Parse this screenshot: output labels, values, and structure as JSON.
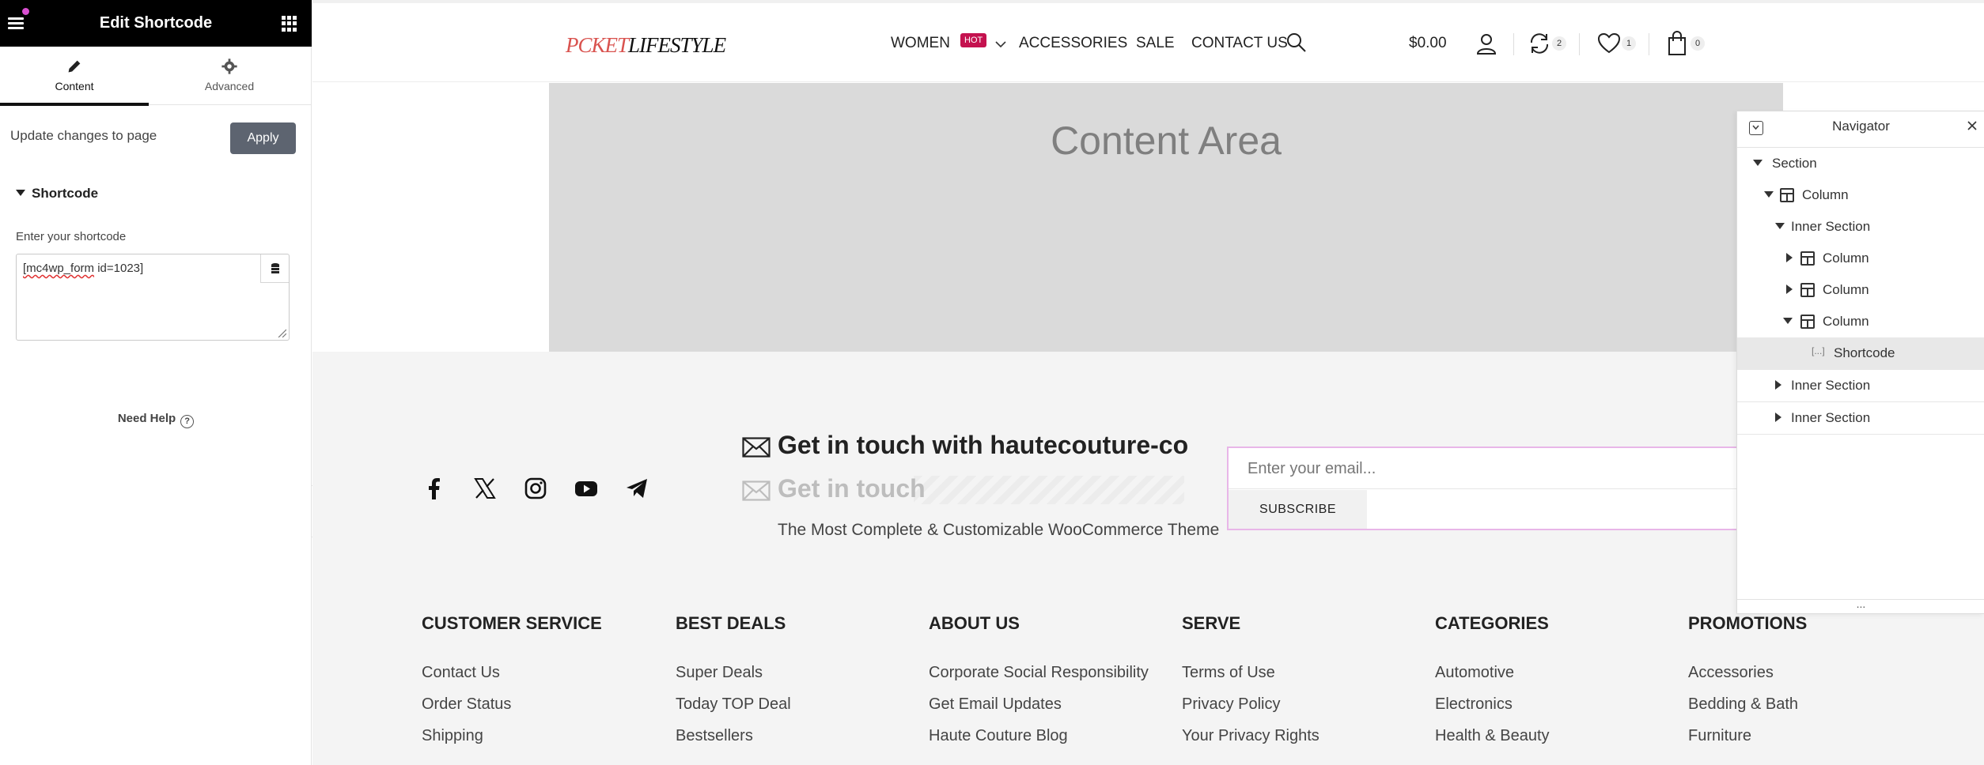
{
  "editor": {
    "title": "Edit Shortcode",
    "tabs": [
      {
        "label": "Content",
        "icon": "pencil-icon",
        "active": true
      },
      {
        "label": "Advanced",
        "icon": "gear-icon",
        "active": false
      }
    ],
    "update_text": "Update changes to page",
    "apply_label": "Apply",
    "section_title": "Shortcode",
    "field_label": "Enter your shortcode",
    "shortcode_value_a": "[mc4wp_form",
    "shortcode_value_b": " id=1023]",
    "help_label": "Need Help",
    "help_icon_glyph": "?"
  },
  "site": {
    "logo_part_a": "PCKET",
    "logo_part_b": "LIFESTYLE",
    "nav": [
      "WOMEN",
      "ACCESSORIES",
      "SALE",
      "CONTACT US"
    ],
    "hot_badge": "HOT",
    "compare_count": "2",
    "wishlist_count": "1",
    "cart_count": "0",
    "cart_total": "$0.00",
    "accent_color": "#c4124f"
  },
  "content": {
    "title": "Content Area"
  },
  "footer": {
    "title": "Get in touch with hautecouture-co",
    "subtitle": "Get in touch",
    "description": "The Most Complete & Customizable WooCommerce Theme",
    "email_placeholder": "Enter your email...",
    "subscribe_label": "SUBSCRIBE",
    "social": [
      "facebook-icon",
      "x-icon",
      "instagram-icon",
      "youtube-icon",
      "telegram-icon"
    ],
    "columns": [
      {
        "heading": "CUSTOMER SERVICE",
        "links": [
          "Contact Us",
          "Order Status",
          "Shipping"
        ]
      },
      {
        "heading": "BEST DEALS",
        "links": [
          "Super Deals",
          "Today TOP Deal",
          "Bestsellers"
        ]
      },
      {
        "heading": "ABOUT US",
        "links": [
          "Corporate Social Responsibility",
          "Get Email Updates",
          "Haute Couture Blog"
        ]
      },
      {
        "heading": "SERVE",
        "links": [
          "Terms of Use",
          "Privacy Policy",
          "Your Privacy Rights"
        ]
      },
      {
        "heading": "CATEGORIES",
        "links": [
          "Automotive",
          "Electronics",
          "Health & Beauty"
        ]
      },
      {
        "heading": "PROMOTIONS",
        "links": [
          "Accessories",
          "Bedding & Bath",
          "Furniture"
        ]
      }
    ]
  },
  "navigator": {
    "title": "Navigator",
    "more_glyph": "...",
    "items": [
      {
        "label": "Section",
        "type": "section",
        "toggle": "down"
      },
      {
        "label": "Column",
        "type": "column",
        "toggle": "down"
      },
      {
        "label": "Inner Section",
        "type": "section",
        "toggle": "down"
      },
      {
        "label": "Column",
        "type": "column",
        "toggle": "right"
      },
      {
        "label": "Column",
        "type": "column",
        "toggle": "right"
      },
      {
        "label": "Column",
        "type": "column",
        "toggle": "down"
      },
      {
        "label": "Shortcode",
        "type": "shortcode",
        "toggle": "none",
        "icon_glyph": "[...]"
      },
      {
        "label": "Inner Section",
        "type": "section",
        "toggle": "right"
      },
      {
        "label": "Inner Section",
        "type": "section",
        "toggle": "right"
      }
    ]
  }
}
